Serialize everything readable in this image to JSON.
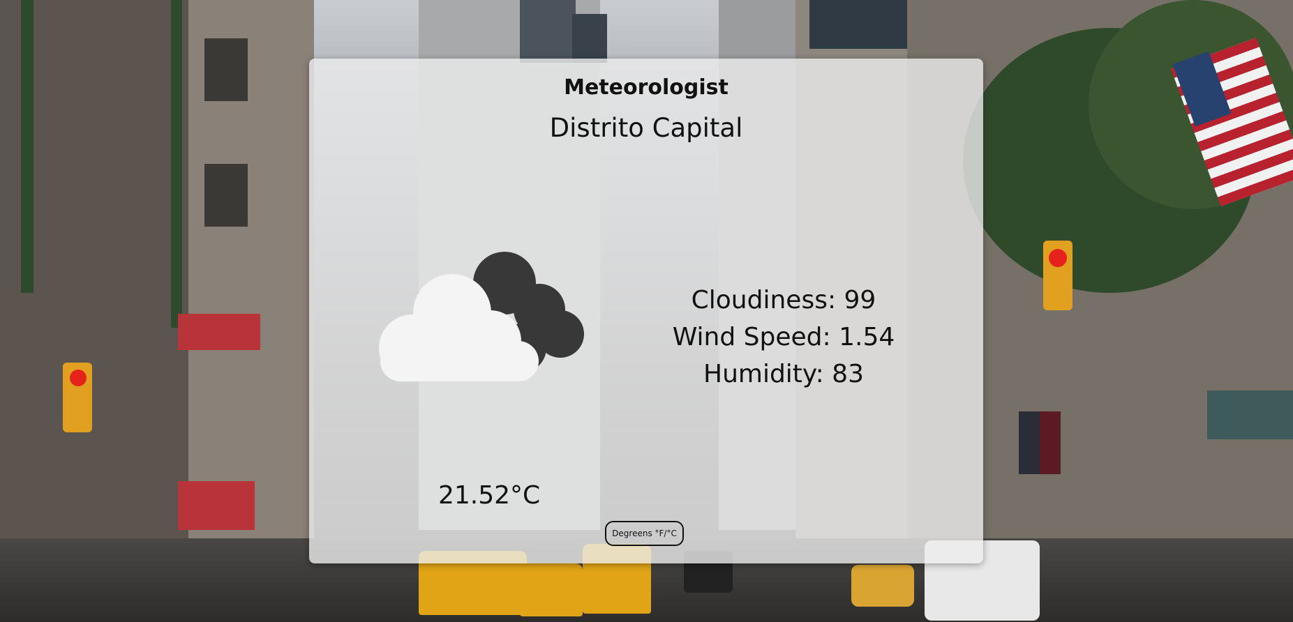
{
  "app": {
    "title": "Meteorologist"
  },
  "weather": {
    "location": "Distrito Capital",
    "condition_icon": "cloud-icon",
    "cloudiness": "Cloudiness: 99",
    "wind_speed": "Wind Speed: 1.54",
    "humidity": "Humidity: 83",
    "temperature": "21.52°C"
  },
  "controls": {
    "unit_toggle_label": "Degreens °F/°C"
  },
  "colors": {
    "card_background": "#ececec",
    "cloud_front": "#f4f4f4",
    "cloud_back": "#383838",
    "text": "#111111"
  }
}
